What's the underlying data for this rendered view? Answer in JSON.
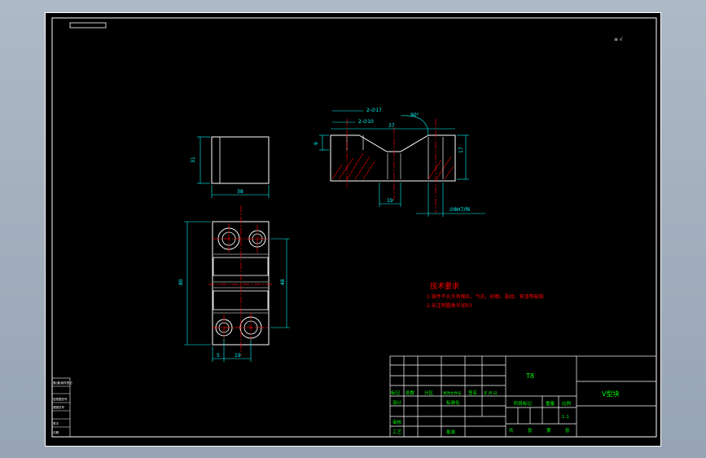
{
  "colors": {
    "background": "#000000",
    "outline": "#ffffff",
    "dimension": "#00ffff",
    "centerline": "#ff0000",
    "hatch": "#ff0000",
    "title_block_text": "#00ff00",
    "tech_requirements": "#ff0000"
  },
  "roughness_note": "≡ √",
  "dimensions": {
    "top_block_height": "31",
    "top_block_width": "38",
    "plan_height": "80",
    "plan_inner_height": "48",
    "plan_offset": "5",
    "plan_hole_spacing": "19",
    "section_chamfer_top": "2-∅17",
    "section_chamfer_bottom": "2-∅10",
    "section_angle": "90°",
    "section_width": "37",
    "section_left_depth": "9",
    "section_right_depth": "17",
    "section_bottom": "19",
    "section_fit": "∅8H7/f6"
  },
  "tech_requirements": {
    "title": "技术要求",
    "items": [
      "1.铸件不允许有缩孔、气孔、砂眼、裂纹、夹渣等缺陷",
      "2.未注明圆角半径R3"
    ]
  },
  "title_block": {
    "material": "T8",
    "part_name": "V型块",
    "scale": "1:1",
    "header_labels": [
      "标记",
      "处数",
      "分区",
      "更改文件号",
      "签名",
      "年.月.日"
    ],
    "row_labels": [
      "设计",
      "审核",
      "工艺"
    ],
    "standardization": "标准化",
    "approve": "批准",
    "stage_mark": "阶段标记",
    "weight": "重量",
    "scale_label": "比例",
    "sheet_labels": [
      "共",
      "张",
      "第",
      "张"
    ]
  },
  "left_strip_labels": [
    "借(通)用件登记",
    "旧底图总号",
    "底图总号",
    "签字",
    "日期"
  ]
}
